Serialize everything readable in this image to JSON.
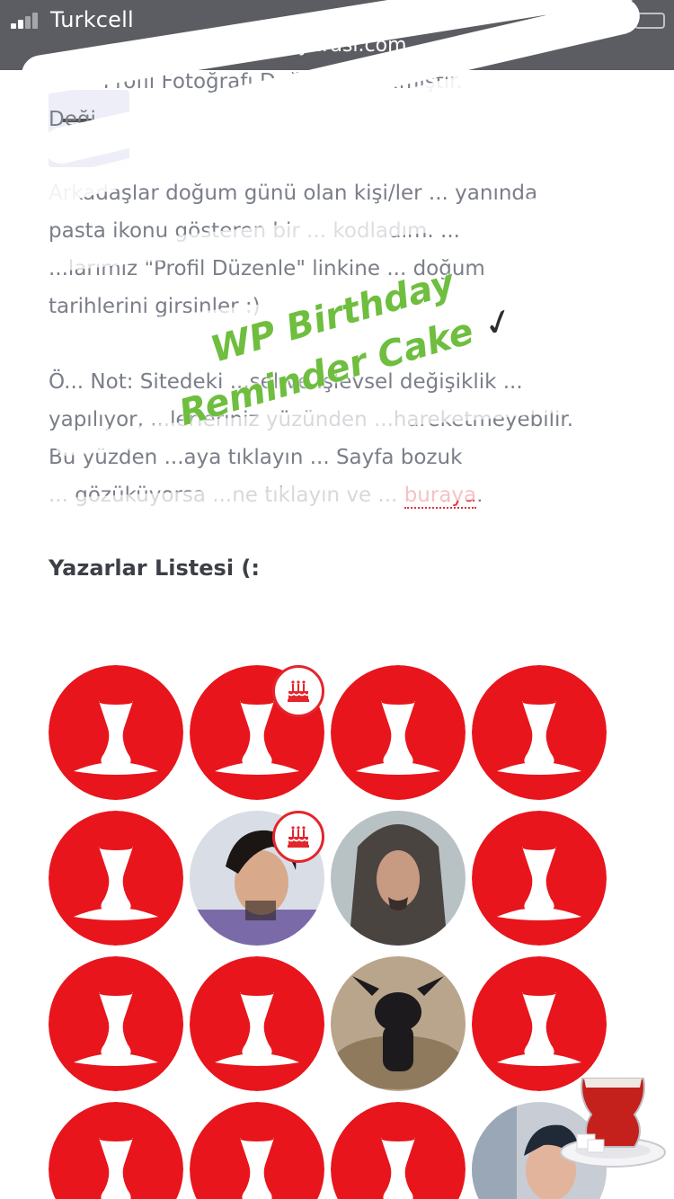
{
  "status_bar": {
    "carrier": "Turkcell"
  },
  "browser": {
    "url": "...ayarasi.com"
  },
  "article": {
    "p1_line1": "...ni \"Profil Fotoğrafı Değiştirici\" ...miştir.",
    "p1_line2": "Deği... ...ilirsiniz",
    "p2_line1": "Arkadaşlar doğum günü olan kişi/ler ... yanında",
    "p2_line2": "pasta ikonu gösteren bir ... kodladım. ...",
    "p2_line3": "...larımız \"Profil Düzenle\" linkine ... doğum",
    "p2_line4": "tarihlerini girsinler :)",
    "p3_line1": "Ö... Not: Sitedeki ...sel ve işlevsel değişiklik ...",
    "p3_line2": "yapılıyor, ...lerleriniz yüzünden ...hareketmeyebilir.",
    "p3_line3": "Bu yüzden ...aya tıklayın ... Sayfa bozuk",
    "p3_line4": "... gözüküyorsa ...ne tıklayın ve ...",
    "p3_link": "buraya",
    "p3_end": "."
  },
  "sticker": {
    "line1": "WP Birthday",
    "line2": "Reminder Cake",
    "check": "✓"
  },
  "authors": {
    "heading": "Yazarlar Listesi (:",
    "items": [
      {
        "type": "default-avatar",
        "birthday": false
      },
      {
        "type": "default-avatar",
        "birthday": true
      },
      {
        "type": "default-avatar",
        "birthday": false
      },
      {
        "type": "default-avatar",
        "birthday": false
      },
      {
        "type": "default-avatar",
        "birthday": false
      },
      {
        "type": "photo-curly-hair-man",
        "birthday": true
      },
      {
        "type": "photo-long-hair-man",
        "birthday": false
      },
      {
        "type": "default-avatar",
        "birthday": false
      },
      {
        "type": "default-avatar",
        "birthday": false
      },
      {
        "type": "default-avatar",
        "birthday": false
      },
      {
        "type": "photo-black-kitten",
        "birthday": false
      },
      {
        "type": "default-avatar",
        "birthday": false
      },
      {
        "type": "default-avatar",
        "birthday": false
      },
      {
        "type": "default-avatar",
        "birthday": false
      },
      {
        "type": "default-avatar",
        "birthday": false
      },
      {
        "type": "photo-woman-glasses",
        "birthday": false
      }
    ]
  },
  "colors": {
    "avatar_red": "#e8151c",
    "sticker_green": "#6fbe3f",
    "link_red": "#e1303a",
    "topbar": "#5b5d62"
  },
  "icons": {
    "birthday_badge": "cake-icon",
    "menu": "hamburger-menu-icon",
    "tea_sticker": "turkish-tea-glass-icon"
  }
}
